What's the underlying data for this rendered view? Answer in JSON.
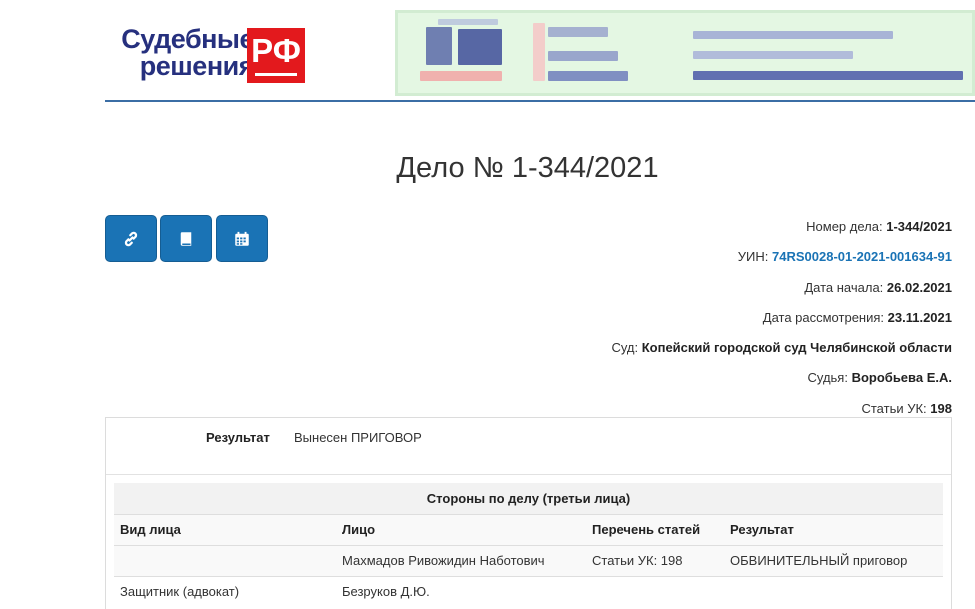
{
  "logo": {
    "line1": "Судебные",
    "line2": "решения",
    "badge": "РФ",
    "brand_color": "#26307e",
    "badge_color": "#e3191d"
  },
  "case": {
    "title": "Дело № 1-344/2021"
  },
  "toolbar": {
    "buttons": [
      {
        "icon": "link-icon"
      },
      {
        "icon": "book-icon"
      },
      {
        "icon": "calendar-icon"
      }
    ],
    "color": "#1a73b5"
  },
  "info": {
    "number_label": "Номер дела:",
    "number_value": "1-344/2021",
    "uin_label": "УИН:",
    "uin_value": "74RS0028-01-2021-001634-91",
    "start_label": "Дата начала:",
    "start_value": "26.02.2021",
    "review_label": "Дата рассмотрения:",
    "review_value": "23.11.2021",
    "court_label": "Суд:",
    "court_value": "Копейский городской суд Челябинской области",
    "judge_label": "Судья:",
    "judge_value": "Воробьева Е.А.",
    "articles_label": "Статьи УК:",
    "articles_value": "198"
  },
  "result": {
    "label": "Результат",
    "value": "Вынесен ПРИГОВОР"
  },
  "parties": {
    "caption": "Стороны по делу (третьи лица)",
    "columns": [
      "Вид лица",
      "Лицо",
      "Перечень статей",
      "Результат"
    ],
    "rows": [
      [
        "",
        "Махмадов Ривожидин Наботович",
        "Статьи УК: 198",
        "ОБВИНИТЕЛЬНЫЙ приговор"
      ],
      [
        "Защитник (адвокат)",
        "Безруков Д.Ю.",
        "",
        ""
      ]
    ]
  }
}
